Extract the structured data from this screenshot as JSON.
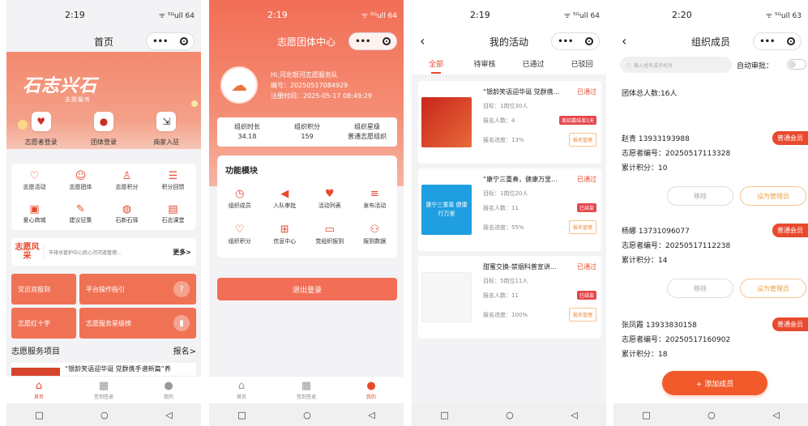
{
  "status": {
    "s1": "2:19",
    "s2": "2:19",
    "s3": "2:19",
    "s4": "2:20",
    "sig": "ᯤ ⁵ᴳull 64",
    "sig4": "ᯤ ⁵ᴳull 63"
  },
  "screen1": {
    "title": "首页",
    "logo_text": "石志兴石",
    "logo_sub": "志愿服务",
    "quick": [
      {
        "label": "志愿者登录",
        "icon": "volunteer-login-icon"
      },
      {
        "label": "团体登录",
        "icon": "group-login-icon"
      },
      {
        "label": "商家入驻",
        "icon": "merchant-icon"
      }
    ],
    "grid": [
      {
        "label": "志愿活动",
        "icon": "heart-icon"
      },
      {
        "label": "志愿团体",
        "icon": "people-icon"
      },
      {
        "label": "志愿积分",
        "icon": "person-icon"
      },
      {
        "label": "积分回馈",
        "icon": "database-icon"
      },
      {
        "label": "爱心商城",
        "icon": "shop-icon"
      },
      {
        "label": "建议征集",
        "icon": "edit-icon"
      },
      {
        "label": "石新石驿",
        "icon": "globe-icon"
      },
      {
        "label": "石志课堂",
        "icon": "book-icon"
      }
    ],
    "news_label": "志愿风采",
    "news_text": "市排水管护中心民心河河道管理...",
    "news_more": "更多>",
    "banners": [
      "党员双报到",
      "平台操作指引",
      "志愿红十字",
      "志愿服务星级榜"
    ],
    "service_title": "志愿服务项目",
    "service_more": "报名>",
    "service_item": "“银龄笑语迎华诞 党群携手谱新篇”养"
  },
  "screen2": {
    "title": "志愿团体中心",
    "greeting": "Hi,河北银河志愿服务队",
    "id_line": "编号：20250517084929",
    "reg_line": "注册时间：2025-05-17 08:49:29",
    "stats": [
      {
        "label": "组织时长",
        "value": "34.18"
      },
      {
        "label": "组织积分",
        "value": "159"
      },
      {
        "label": "组织星级",
        "value": "普通志愿组织"
      }
    ],
    "func_title": "功能模块",
    "funcs": [
      {
        "label": "组织成员",
        "icon": "clock-icon"
      },
      {
        "label": "入队审批",
        "icon": "megaphone-icon"
      },
      {
        "label": "活动列表",
        "icon": "hands-icon"
      },
      {
        "label": "发布活动",
        "icon": "coins-icon"
      },
      {
        "label": "组织积分",
        "icon": "heart-outline-icon"
      },
      {
        "label": "信息中心",
        "icon": "plus-box-icon"
      },
      {
        "label": "党组织报到",
        "icon": "id-card-icon"
      },
      {
        "label": "报到数据",
        "icon": "group-icon"
      }
    ],
    "logout": "退出登录"
  },
  "screen3": {
    "title": "我的活动",
    "tabs": [
      "全部",
      "待审核",
      "已通过",
      "已驳回"
    ],
    "cards": [
      {
        "title": "“银龄笑语迎华诞 党群携...",
        "state": "已通过",
        "target": "目标：1岗位30人",
        "signup": "报名人数：4",
        "progress": "报名进度：13%",
        "badge": "离招募结束1天",
        "manage": "报名管理"
      },
      {
        "title": "“康宁三重奏，健康万里...",
        "state": "已通过",
        "target": "目标：1岗位20人",
        "signup": "报名人数：11",
        "progress": "报名进度：55%",
        "badge": "已结束",
        "manage": "报名管理"
      },
      {
        "title": "甜蜜交换-禁烟科普宣讲...",
        "state": "已通过",
        "target": "目标：5岗位11人",
        "signup": "报名人数：11",
        "progress": "报名进度：100%",
        "badge": "已结束",
        "manage": "报名管理"
      }
    ],
    "card2_img_text": "康宁三重奏 健康行万里"
  },
  "screen4": {
    "title": "组织成员",
    "search_placeholder": "输入姓名或手机号",
    "auto_label": "自动审批：",
    "total": "团体总人数:16人",
    "members": [
      {
        "name": "赵青  13933193988",
        "role": "普通会员",
        "no": "志愿者编号：20250517113328",
        "points": "累计积分：10"
      },
      {
        "name": "杨娜  13731096077",
        "role": "普通会员",
        "no": "志愿者编号：20250517112238",
        "points": "累计积分：14"
      },
      {
        "name": "张凤霞  13933830158",
        "role": "普通会员",
        "no": "志愿者编号：20250517160902",
        "points": "累计积分：18"
      }
    ],
    "remove": "移除",
    "set_admin": "设为管理员",
    "add": "+ 添加成员"
  },
  "tabbar": [
    {
      "label": "首页",
      "icon": "home-icon"
    },
    {
      "label": "签到签退",
      "icon": "checkin-icon"
    },
    {
      "label": "我的",
      "icon": "user-icon"
    }
  ],
  "colors": {
    "accent": "#e84a2e",
    "orange": "#f26e56"
  }
}
